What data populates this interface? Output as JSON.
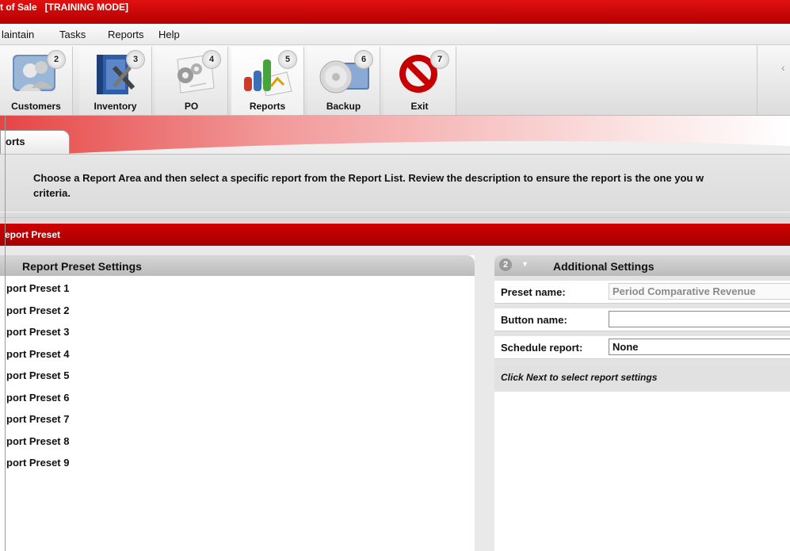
{
  "window": {
    "title": "t of Sale   [TRAINING MODE]"
  },
  "menu": {
    "items": [
      "laintain",
      "Tasks",
      "Reports",
      "Help"
    ]
  },
  "toolbar": {
    "buttons": [
      {
        "num": "2",
        "label": "Customers",
        "icon": "customers-icon"
      },
      {
        "num": "3",
        "label": "Inventory",
        "icon": "inventory-icon"
      },
      {
        "num": "4",
        "label": "PO",
        "icon": "po-icon"
      },
      {
        "num": "5",
        "label": "Reports",
        "icon": "reports-icon"
      },
      {
        "num": "6",
        "label": "Backup",
        "icon": "backup-icon"
      },
      {
        "num": "7",
        "label": "Exit",
        "icon": "exit-icon"
      }
    ]
  },
  "tab": {
    "label": "orts"
  },
  "instructions": {
    "line1": "Choose a Report Area and then select a specific report from the Report List. Review the description to ensure the report is the one you w",
    "line2": "criteria."
  },
  "section": {
    "title": "eport Preset"
  },
  "left_panel": {
    "title": "Report Preset Settings",
    "items": [
      "port Preset 1",
      "port Preset 2",
      "port Preset 3",
      "port Preset 4",
      "port Preset 5",
      "port Preset 6",
      "port Preset 7",
      "port Preset 8",
      "port Preset 9"
    ]
  },
  "right_panel": {
    "step": "2",
    "title": "Additional Settings",
    "preset_name_label": "Preset name:",
    "preset_name_value": "Period Comparative Revenue",
    "button_name_label": "Button name:",
    "button_name_value": "",
    "schedule_label": "Schedule report:",
    "schedule_value": "None",
    "hint": "Click Next to select report settings"
  },
  "colors": {
    "brand_red": "#c80000",
    "panel_gray": "#c8c8c8"
  }
}
